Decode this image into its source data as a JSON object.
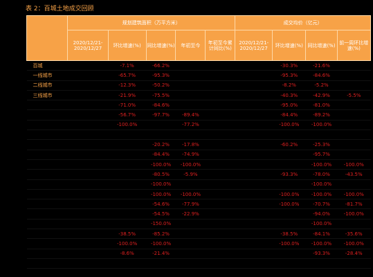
{
  "caption": "表 2：百城土地成交回顾",
  "header": {
    "area_group": "规划建筑面积（万平方米）",
    "price_group": "成交均价（亿元）",
    "cols": [
      "2020/12/21-2020/12/27",
      "环比增速(%)",
      "同比增速(%)",
      "年初至今",
      "年初至今累计同比(%)",
      "2020/12/21-2020/12/27",
      "环比增速(%)",
      "同比增速(%)",
      "前一周环比增速(%)"
    ]
  },
  "rows": [
    {
      "city": "百城",
      "c": [
        "",
        "-7.1%",
        "-66.2%",
        "",
        "",
        "",
        "-30.3%",
        "-21.6%",
        ""
      ],
      "t": [
        "",
        "n",
        "n",
        "",
        "",
        "",
        "n",
        "n",
        ""
      ]
    },
    {
      "city": "一线城市",
      "c": [
        "",
        "-65.7%",
        "-95.3%",
        "",
        "",
        "",
        "-95.3%",
        "-84.6%",
        ""
      ],
      "t": [
        "",
        "n",
        "n",
        "",
        "",
        "",
        "n",
        "n",
        ""
      ]
    },
    {
      "city": "二线城市",
      "c": [
        "",
        "-12.3%",
        "-50.2%",
        "",
        "",
        "",
        "-8.2%",
        "-5.2%",
        ""
      ],
      "t": [
        "",
        "n",
        "n",
        "",
        "",
        "",
        "n",
        "n",
        ""
      ]
    },
    {
      "city": "三线城市",
      "c": [
        "",
        "-21.9%",
        "-75.5%",
        "",
        "",
        "",
        "-40.3%",
        "-42.9%",
        "-5.5%"
      ],
      "t": [
        "",
        "n",
        "n",
        "",
        "",
        "",
        "n",
        "n",
        "n"
      ]
    },
    {
      "city": "",
      "c": [
        "",
        "-71.0%",
        "-84.6%",
        "",
        "",
        "",
        "-95.0%",
        "-81.0%",
        ""
      ],
      "t": [
        "",
        "n",
        "n",
        "",
        "",
        "",
        "n",
        "n",
        ""
      ]
    },
    {
      "city": "",
      "c": [
        "",
        "-56.7%",
        "-97.7%",
        "-89.4%",
        "",
        "",
        "-84.4%",
        "-89.2%",
        ""
      ],
      "t": [
        "",
        "n",
        "n",
        "n",
        "",
        "",
        "n",
        "n",
        ""
      ]
    },
    {
      "city": "",
      "c": [
        "",
        "-100.0%",
        "",
        "-77.2%",
        "",
        "",
        "-100.0%",
        "-100.0%",
        ""
      ],
      "t": [
        "",
        "n",
        "",
        "n",
        "",
        "",
        "n",
        "n",
        ""
      ]
    },
    {
      "city": "",
      "c": [
        "",
        "",
        "",
        "",
        "",
        "",
        "",
        "",
        ""
      ],
      "t": [
        "",
        "",
        "",
        "",
        "",
        "",
        "",
        "",
        ""
      ]
    },
    {
      "city": "",
      "c": [
        "",
        "",
        "-20.2%",
        "-17.8%",
        "",
        "",
        "-60.2%",
        "-25.3%",
        ""
      ],
      "t": [
        "",
        "",
        "n",
        "n",
        "",
        "",
        "n",
        "n",
        ""
      ]
    },
    {
      "city": "",
      "c": [
        "",
        "",
        "-84.4%",
        "-74.9%",
        "",
        "",
        "",
        "-95.7%",
        ""
      ],
      "t": [
        "",
        "",
        "n",
        "n",
        "",
        "",
        "",
        "n",
        ""
      ]
    },
    {
      "city": "",
      "c": [
        "",
        "",
        "-100.0%",
        "-100.0%",
        "",
        "",
        "",
        "-100.0%",
        "-100.0%"
      ],
      "t": [
        "",
        "",
        "n",
        "n",
        "",
        "",
        "",
        "n",
        "n"
      ]
    },
    {
      "city": "",
      "c": [
        "",
        "",
        "-80.5%",
        "-5.9%",
        "",
        "",
        "-93.3%",
        "-78.0%",
        "-43.5%"
      ],
      "t": [
        "",
        "",
        "n",
        "n",
        "",
        "",
        "n",
        "n",
        "n"
      ]
    },
    {
      "city": "",
      "c": [
        "",
        "",
        "-100.0%",
        "",
        "",
        "",
        "",
        "-100.0%",
        ""
      ],
      "t": [
        "",
        "",
        "n",
        "",
        "",
        "",
        "",
        "n",
        ""
      ]
    },
    {
      "city": "",
      "c": [
        "",
        "",
        "-100.0%",
        "-100.0%",
        "",
        "",
        "-100.0%",
        "-100.0%",
        "-100.0%"
      ],
      "t": [
        "",
        "",
        "n",
        "n",
        "",
        "",
        "n",
        "n",
        "n"
      ]
    },
    {
      "city": "",
      "c": [
        "",
        "",
        "-54.6%",
        "-77.9%",
        "",
        "",
        "-100.0%",
        "-70.7%",
        "-81.7%"
      ],
      "t": [
        "",
        "",
        "n",
        "n",
        "",
        "",
        "n",
        "n",
        "n"
      ]
    },
    {
      "city": "",
      "c": [
        "",
        "",
        "-54.5%",
        "-22.9%",
        "",
        "",
        "",
        "-94.0%",
        "-100.0%"
      ],
      "t": [
        "",
        "",
        "n",
        "n",
        "",
        "",
        "",
        "n",
        "n"
      ]
    },
    {
      "city": "",
      "c": [
        "",
        "",
        "-150.0%",
        "",
        "",
        "",
        "",
        "-100.0%",
        ""
      ],
      "t": [
        "",
        "",
        "n",
        "",
        "",
        "",
        "",
        "n",
        ""
      ]
    },
    {
      "city": "",
      "c": [
        "",
        "-38.5%",
        "-85.2%",
        "",
        "",
        "",
        "-38.5%",
        "-84.1%",
        "-35.6%"
      ],
      "t": [
        "",
        "n",
        "n",
        "",
        "",
        "",
        "n",
        "n",
        "n"
      ]
    },
    {
      "city": "",
      "c": [
        "",
        "-100.0%",
        "-100.0%",
        "",
        "",
        "",
        "-100.0%",
        "-100.0%",
        "-100.0%"
      ],
      "t": [
        "",
        "n",
        "n",
        "",
        "",
        "",
        "n",
        "n",
        "n"
      ]
    },
    {
      "city": "",
      "c": [
        "",
        "-8.6%",
        "-21.4%",
        "",
        "",
        "",
        "",
        "-93.3%",
        "-28.4%"
      ],
      "t": [
        "",
        "n",
        "n",
        "",
        "",
        "",
        "",
        "n",
        "n"
      ]
    },
    {
      "city": "",
      "c": [
        "",
        "",
        "",
        "",
        "",
        "",
        "",
        "",
        ""
      ],
      "t": [
        "",
        "",
        "",
        "",
        "",
        "",
        "",
        "",
        ""
      ]
    }
  ]
}
